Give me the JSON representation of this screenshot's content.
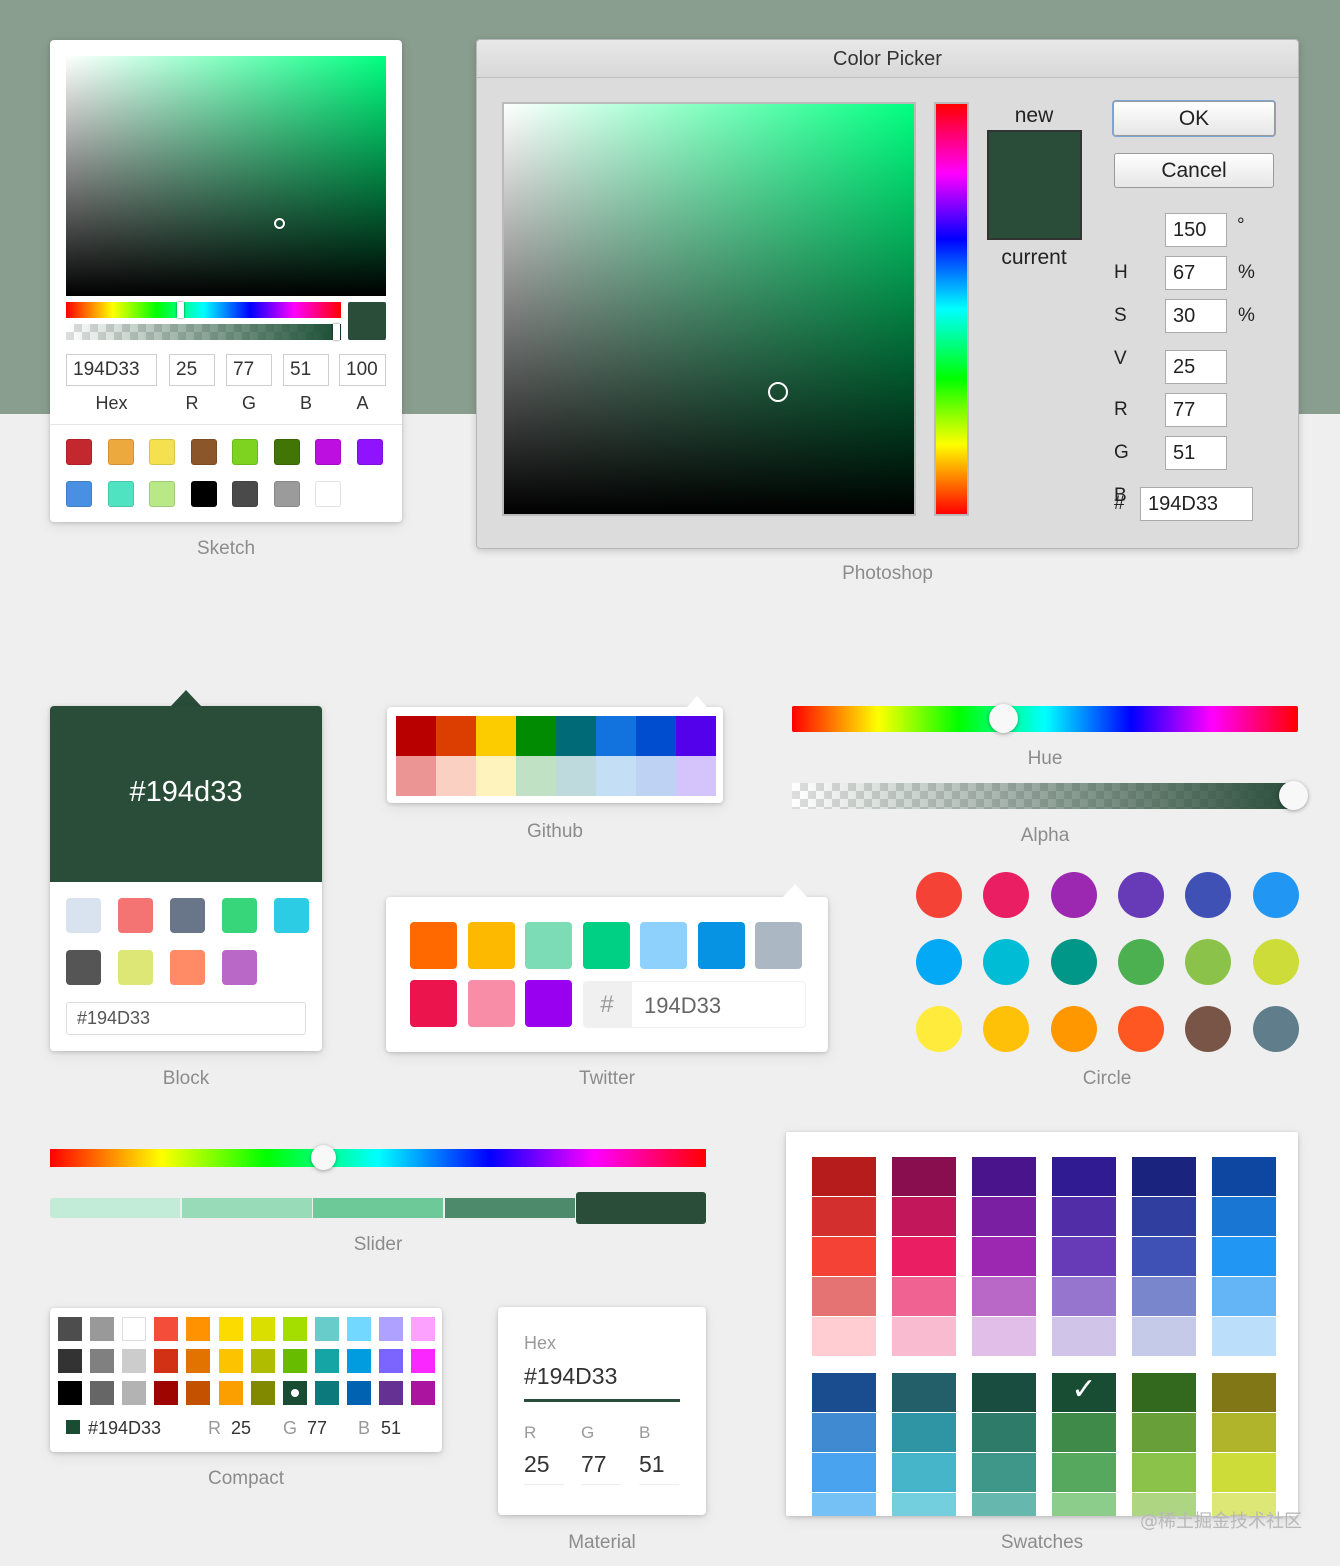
{
  "current_color": "#194D33",
  "sketch": {
    "caption": "Sketch",
    "hex": "194D33",
    "r": "25",
    "g": "77",
    "b": "51",
    "a": "100",
    "labels": {
      "hex": "Hex",
      "r": "R",
      "g": "G",
      "b": "B",
      "a": "A"
    },
    "presets": [
      "#c3282e",
      "#eba93e",
      "#f5e14f",
      "#8b572a",
      "#7ed321",
      "#417505",
      "#bd10e0",
      "#9013fe",
      "#4a90e2",
      "#50e3c2",
      "#b8e986",
      "#000000",
      "#4a4a4a",
      "#9b9b9b",
      "#ffffff"
    ]
  },
  "photoshop": {
    "caption": "Photoshop",
    "title": "Color Picker",
    "ok": "OK",
    "cancel": "Cancel",
    "new_label": "new",
    "current_label": "current",
    "h": "150",
    "h_unit": "°",
    "s": "67",
    "s_unit": "%",
    "v": "30",
    "v_unit": "%",
    "r": "25",
    "g": "77",
    "b": "51",
    "hex": "194D33",
    "labels": {
      "h": "H",
      "s": "S",
      "v": "V",
      "r": "R",
      "g": "G",
      "b": "B",
      "hash": "#"
    }
  },
  "block": {
    "caption": "Block",
    "display": "#194d33",
    "input": "#194D33",
    "colors": [
      "#d9e3f0",
      "#f47373",
      "#697689",
      "#37d67a",
      "#2ccce4",
      "#555555",
      "#dce775",
      "#ff8a65",
      "#ba68c8"
    ]
  },
  "github": {
    "caption": "Github",
    "colors": [
      "#b80000",
      "#db3e00",
      "#fccb00",
      "#008b02",
      "#006b76",
      "#1273de",
      "#004dcf",
      "#5300eb",
      "#eb9694",
      "#fad0c3",
      "#fef3bd",
      "#c1e1c5",
      "#bedadc",
      "#c4def6",
      "#bed3f3",
      "#d4c4fb"
    ]
  },
  "hue_alpha": {
    "hue_caption": "Hue",
    "alpha_caption": "Alpha",
    "hue_value": 150,
    "alpha_value": 1
  },
  "twitter": {
    "caption": "Twitter",
    "colors": [
      "#ff6900",
      "#fcb900",
      "#7bdcb5",
      "#00d084",
      "#8ed1fc",
      "#0693e3",
      "#abb8c3",
      "#eb144c",
      "#f78da7",
      "#9900ef"
    ],
    "hash": "#",
    "input": "194D33"
  },
  "circle": {
    "caption": "Circle",
    "colors": [
      "#f44336",
      "#e91e63",
      "#9c27b0",
      "#673ab7",
      "#3f51b5",
      "#2196f3",
      "#03a9f4",
      "#00bcd4",
      "#009688",
      "#4caf50",
      "#8bc34a",
      "#cddc39",
      "#ffeb3b",
      "#ffc107",
      "#ff9800",
      "#ff5722",
      "#795548",
      "#607d8b"
    ]
  },
  "slider": {
    "caption": "Slider",
    "hue_value": 150,
    "swatches": [
      "#c2ecd8",
      "#98dbb9",
      "#6dca98",
      "#4d8a6b",
      "#2a4d3a"
    ]
  },
  "compact": {
    "caption": "Compact",
    "colors": [
      "#4d4d4d",
      "#999999",
      "#ffffff",
      "#f44e3b",
      "#fe9200",
      "#fcdc00",
      "#dbdf00",
      "#a4dd00",
      "#68ccca",
      "#73d8ff",
      "#aea1ff",
      "#fda1ff",
      "#333333",
      "#808080",
      "#cccccc",
      "#d33115",
      "#e27300",
      "#fcc400",
      "#b0bc00",
      "#68bc00",
      "#16a5a5",
      "#009ce0",
      "#7b64ff",
      "#fa28ff",
      "#000000",
      "#666666",
      "#b3b3b3",
      "#9f0500",
      "#c45100",
      "#fb9e00",
      "#808900",
      "#194d33",
      "#0c797d",
      "#0062b1",
      "#653294",
      "#ab149e"
    ],
    "selected_index": 31,
    "hex": "#194D33",
    "r_label": "R",
    "r": "25",
    "g_label": "G",
    "g": "77",
    "b_label": "B",
    "b": "51"
  },
  "material": {
    "caption": "Material",
    "hex_label": "Hex",
    "hex": "#194D33",
    "r_label": "R",
    "r": "25",
    "g_label": "G",
    "g": "77",
    "b_label": "B",
    "b": "51"
  },
  "swatches": {
    "caption": "Swatches",
    "groups": [
      [
        "#b71c1c",
        "#d32f2f",
        "#f44336",
        "#e57373",
        "#ffcdd2"
      ],
      [
        "#880e4f",
        "#c2185b",
        "#e91e63",
        "#f06292",
        "#f8bbd0"
      ],
      [
        "#4a148c",
        "#7b1fa2",
        "#9c27b0",
        "#ba68c8",
        "#e1bee7"
      ],
      [
        "#311b92",
        "#512da8",
        "#673ab7",
        "#9575cd",
        "#d1c4e9"
      ],
      [
        "#1a237e",
        "#303f9f",
        "#3f51b5",
        "#7986cb",
        "#c5cae9"
      ],
      [
        "#0d47a1",
        "#1976d2",
        "#2196f3",
        "#64b5f6",
        "#bbdefb"
      ],
      [
        "#194d90",
        "#3f8ad1",
        "#4aa3ee",
        "#75c0f5"
      ],
      [
        "#225f68",
        "#2f95a4",
        "#47b5c9",
        "#73cfde"
      ],
      [
        "#194d40",
        "#2e7b6a",
        "#3f978a",
        "#66b8ae"
      ],
      [
        "#194d33",
        "#3f8a48",
        "#55a85e",
        "#8ccd8c"
      ],
      [
        "#33691e",
        "#689f38",
        "#8bc34a",
        "#aed581"
      ],
      [
        "#827717",
        "#afb42b",
        "#cddc39",
        "#dce775"
      ]
    ],
    "check": "✓",
    "watermark": "@稀土掘金技术社区"
  }
}
